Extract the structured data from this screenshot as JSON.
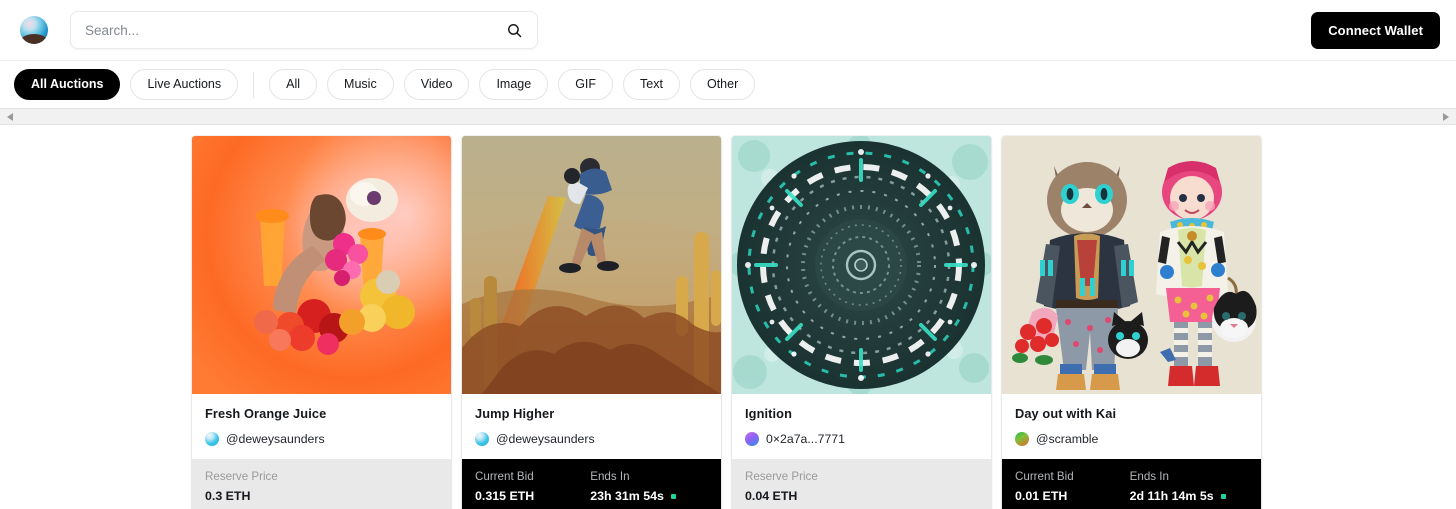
{
  "header": {
    "logo_name": "logo-sphere",
    "search": {
      "value": "",
      "placeholder": "Search...",
      "icon": "search-icon"
    },
    "wallet_button": "Connect Wallet"
  },
  "filters": {
    "groups": [
      [
        {
          "label": "All Auctions",
          "active": true
        },
        {
          "label": "Live Auctions",
          "active": false
        }
      ],
      [
        {
          "label": "All",
          "active": false
        },
        {
          "label": "Music",
          "active": false
        },
        {
          "label": "Video",
          "active": false
        },
        {
          "label": "Image",
          "active": false
        },
        {
          "label": "GIF",
          "active": false
        },
        {
          "label": "Text",
          "active": false
        },
        {
          "label": "Other",
          "active": false
        }
      ]
    ]
  },
  "scrollbar": {
    "left_arrow": "scroll-left-arrow",
    "right_arrow": "scroll-right-arrow"
  },
  "cards": [
    {
      "title": "Fresh Orange Juice",
      "creator": "@deweysaunders",
      "avatar_style": "av-cyan",
      "art": "orange-collage",
      "footer_type": "reserve",
      "price_label": "Reserve Price",
      "price_value": "0.3 ETH",
      "time_label": "",
      "time_value": ""
    },
    {
      "title": "Jump Higher",
      "creator": "@deweysaunders",
      "avatar_style": "av-cyan",
      "art": "desert-jump",
      "footer_type": "live",
      "price_label": "Current Bid",
      "price_value": "0.315 ETH",
      "time_label": "Ends In",
      "time_value": "23h 31m 54s"
    },
    {
      "title": "Ignition",
      "creator": "0×2a7a...7771",
      "avatar_style": "av-purple",
      "art": "teal-mandala",
      "footer_type": "reserve",
      "price_label": "Reserve Price",
      "price_value": "0.04 ETH",
      "time_label": "",
      "time_value": ""
    },
    {
      "title": "Day out with Kai",
      "creator": "@scramble",
      "avatar_style": "av-green",
      "art": "cat-girl-illustration",
      "footer_type": "live",
      "price_label": "Current Bid",
      "price_value": "0.01 ETH",
      "time_label": "Ends In",
      "time_value": "2d 11h 14m 5s"
    }
  ],
  "colors": {
    "accent_black": "#000000",
    "live_dot": "#1dd6a0",
    "reserve_footer_bg": "#e9e9e9",
    "page_bg": "#ffffff"
  }
}
